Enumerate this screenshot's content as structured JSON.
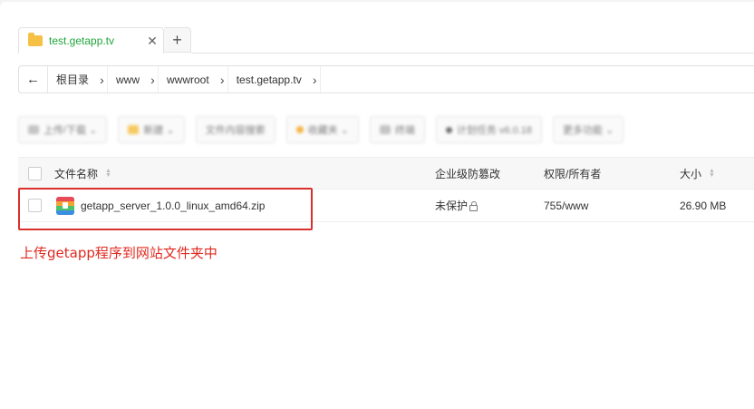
{
  "tab": {
    "title": "test.getapp.tv",
    "close": "✕",
    "add": "+"
  },
  "breadcrumb": {
    "back": "←",
    "items": [
      "根目录",
      "www",
      "wwwroot",
      "test.getapp.tv"
    ],
    "separator": "›"
  },
  "toolbar": {
    "buttons": [
      "上传/下载 ⌄",
      "新建 ⌄",
      "文件内容搜索",
      "收藏夹 ⌄",
      "终端",
      "计划任务 v6.0.18",
      "更多功能 ⌄"
    ]
  },
  "table": {
    "headers": {
      "name": "文件名称",
      "protect": "企业级防篡改",
      "perm": "权限/所有者",
      "size": "大小"
    },
    "rows": [
      {
        "name": "getapp_server_1.0.0_linux_amd64.zip",
        "protect": "未保护",
        "perm": "755/www",
        "size": "26.90 MB"
      }
    ]
  },
  "annotation": {
    "text": "上传getapp程序到网站文件夹中",
    "color": "#e0281f"
  },
  "colors": {
    "accent": "#20a53a",
    "highlight": "#d9302c"
  }
}
